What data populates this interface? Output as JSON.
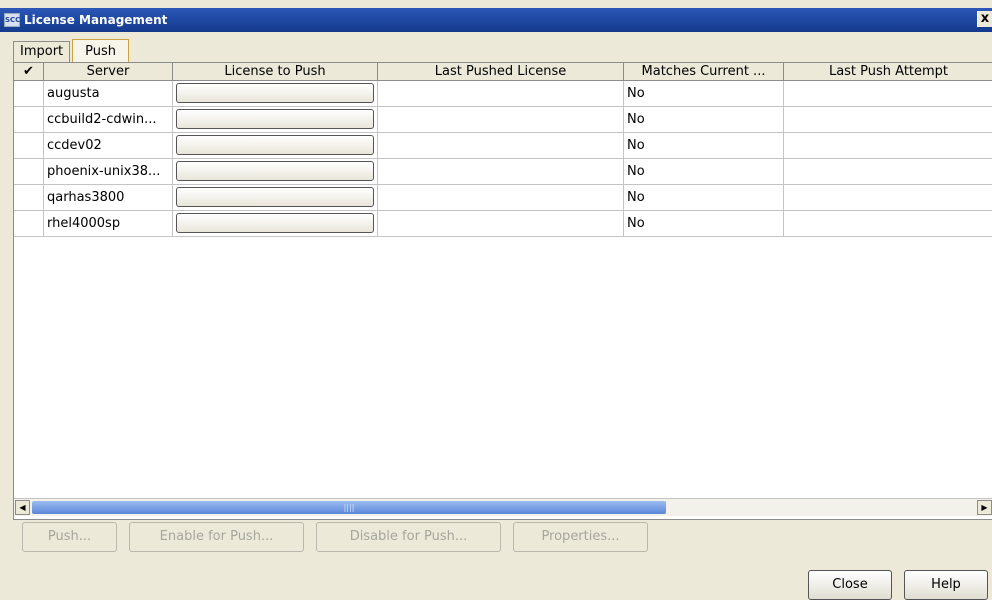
{
  "window": {
    "title": "License Management",
    "icon_text": "SCC",
    "close_symbol": "x"
  },
  "tabs": [
    {
      "label": "Import"
    },
    {
      "label": "Push"
    }
  ],
  "table": {
    "columns": [
      "✔",
      "Server",
      "License to Push",
      "Last Pushed License",
      "Matches Current ...",
      "Last Push Attempt"
    ],
    "rows": [
      {
        "server": "augusta",
        "last_pushed": "",
        "matches": "No",
        "last_attempt": ""
      },
      {
        "server": "ccbuild2-cdwin...",
        "last_pushed": "",
        "matches": "No",
        "last_attempt": ""
      },
      {
        "server": "ccdev02",
        "last_pushed": "",
        "matches": "No",
        "last_attempt": ""
      },
      {
        "server": "phoenix-unix38...",
        "last_pushed": "",
        "matches": "No",
        "last_attempt": ""
      },
      {
        "server": "qarhas3800",
        "last_pushed": "",
        "matches": "No",
        "last_attempt": ""
      },
      {
        "server": "rhel4000sp",
        "last_pushed": "",
        "matches": "No",
        "last_attempt": ""
      }
    ]
  },
  "scrollbar": {
    "left_arrow": "◀",
    "right_arrow": "▶",
    "grip": "||||"
  },
  "actions": {
    "push": "Push...",
    "enable": "Enable for Push...",
    "disable": "Disable for Push...",
    "properties": "Properties..."
  },
  "footer": {
    "close": "Close",
    "help": "Help"
  }
}
